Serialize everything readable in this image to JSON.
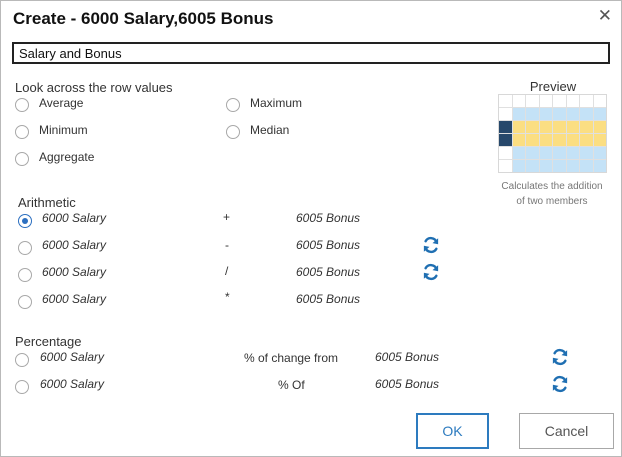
{
  "dialog": {
    "title": "Create - 6000 Salary,6005 Bonus",
    "close_symbol": "✕",
    "name_value": "Salary and Bonus"
  },
  "row_values": {
    "label": "Look across the row values",
    "options": [
      "Average",
      "Maximum",
      "Minimum",
      "Median",
      "Aggregate"
    ]
  },
  "preview": {
    "title": "Preview",
    "note_line1": "Calculates the addition",
    "note_line2": "of two members"
  },
  "arithmetic": {
    "label": "Arithmetic",
    "rows": [
      {
        "left": "6000 Salary",
        "op": "+",
        "right": "6005 Bonus",
        "checked": true,
        "swap": false
      },
      {
        "left": "6000 Salary",
        "op": "-",
        "right": "6005 Bonus",
        "checked": false,
        "swap": true
      },
      {
        "left": "6000 Salary",
        "op": "/",
        "right": "6005 Bonus",
        "checked": false,
        "swap": true
      },
      {
        "left": "6000 Salary",
        "op": "*",
        "right": "6005 Bonus",
        "checked": false,
        "swap": false
      }
    ]
  },
  "percentage": {
    "label": "Percentage",
    "rows": [
      {
        "left": "6000 Salary",
        "op": "% of change from",
        "right": "6005 Bonus",
        "swap": true
      },
      {
        "left": "6000 Salary",
        "op": "% Of",
        "right": "6005 Bonus",
        "swap": true
      }
    ]
  },
  "buttons": {
    "ok": "OK",
    "cancel": "Cancel"
  },
  "colors": {
    "accent": "#2c6fc0",
    "refresh_icon": "#1f6fb2",
    "preview_blue": "#c4e2f7",
    "preview_yellow": "#fbde82",
    "preview_dark": "#27486b"
  },
  "icons": {
    "close": "close-icon",
    "swap": "refresh-swap-icon"
  }
}
